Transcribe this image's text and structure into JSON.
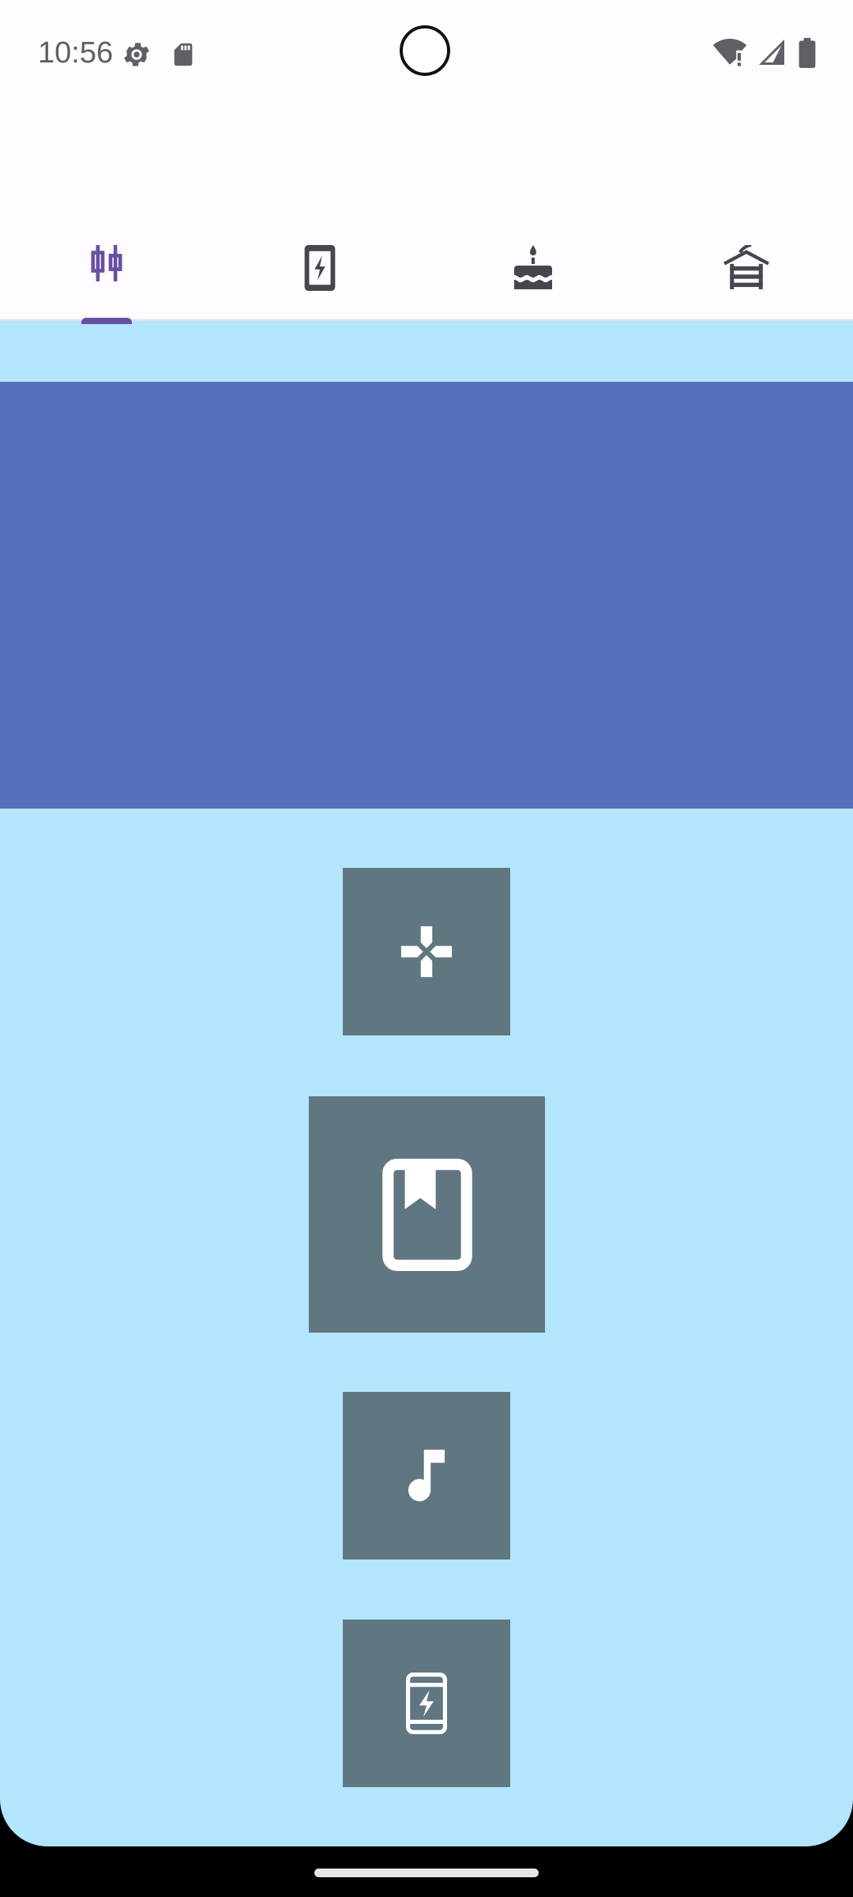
{
  "status_bar": {
    "time": "10:56",
    "left_icons": [
      "settings-gear-icon",
      "sd-card-icon"
    ],
    "right_icons": [
      "wifi-alert-icon",
      "cellular-signal-icon",
      "battery-icon"
    ]
  },
  "tabs": [
    {
      "icon": "candlestick-chart-icon",
      "selected": true
    },
    {
      "icon": "mobile-charging-icon",
      "selected": false
    },
    {
      "icon": "cake-icon",
      "selected": false
    },
    {
      "icon": "gazebo-icon",
      "selected": false
    }
  ],
  "colors": {
    "background": "#b3e5fc",
    "banner": "#5670bb",
    "tile": "#607781",
    "accent": "#6750a4",
    "surface": "#fffbfe"
  },
  "tiles": [
    {
      "icon": "gamepad-icon"
    },
    {
      "icon": "book-bookmark-icon"
    },
    {
      "icon": "music-note-icon"
    },
    {
      "icon": "mobile-charging-icon"
    }
  ]
}
